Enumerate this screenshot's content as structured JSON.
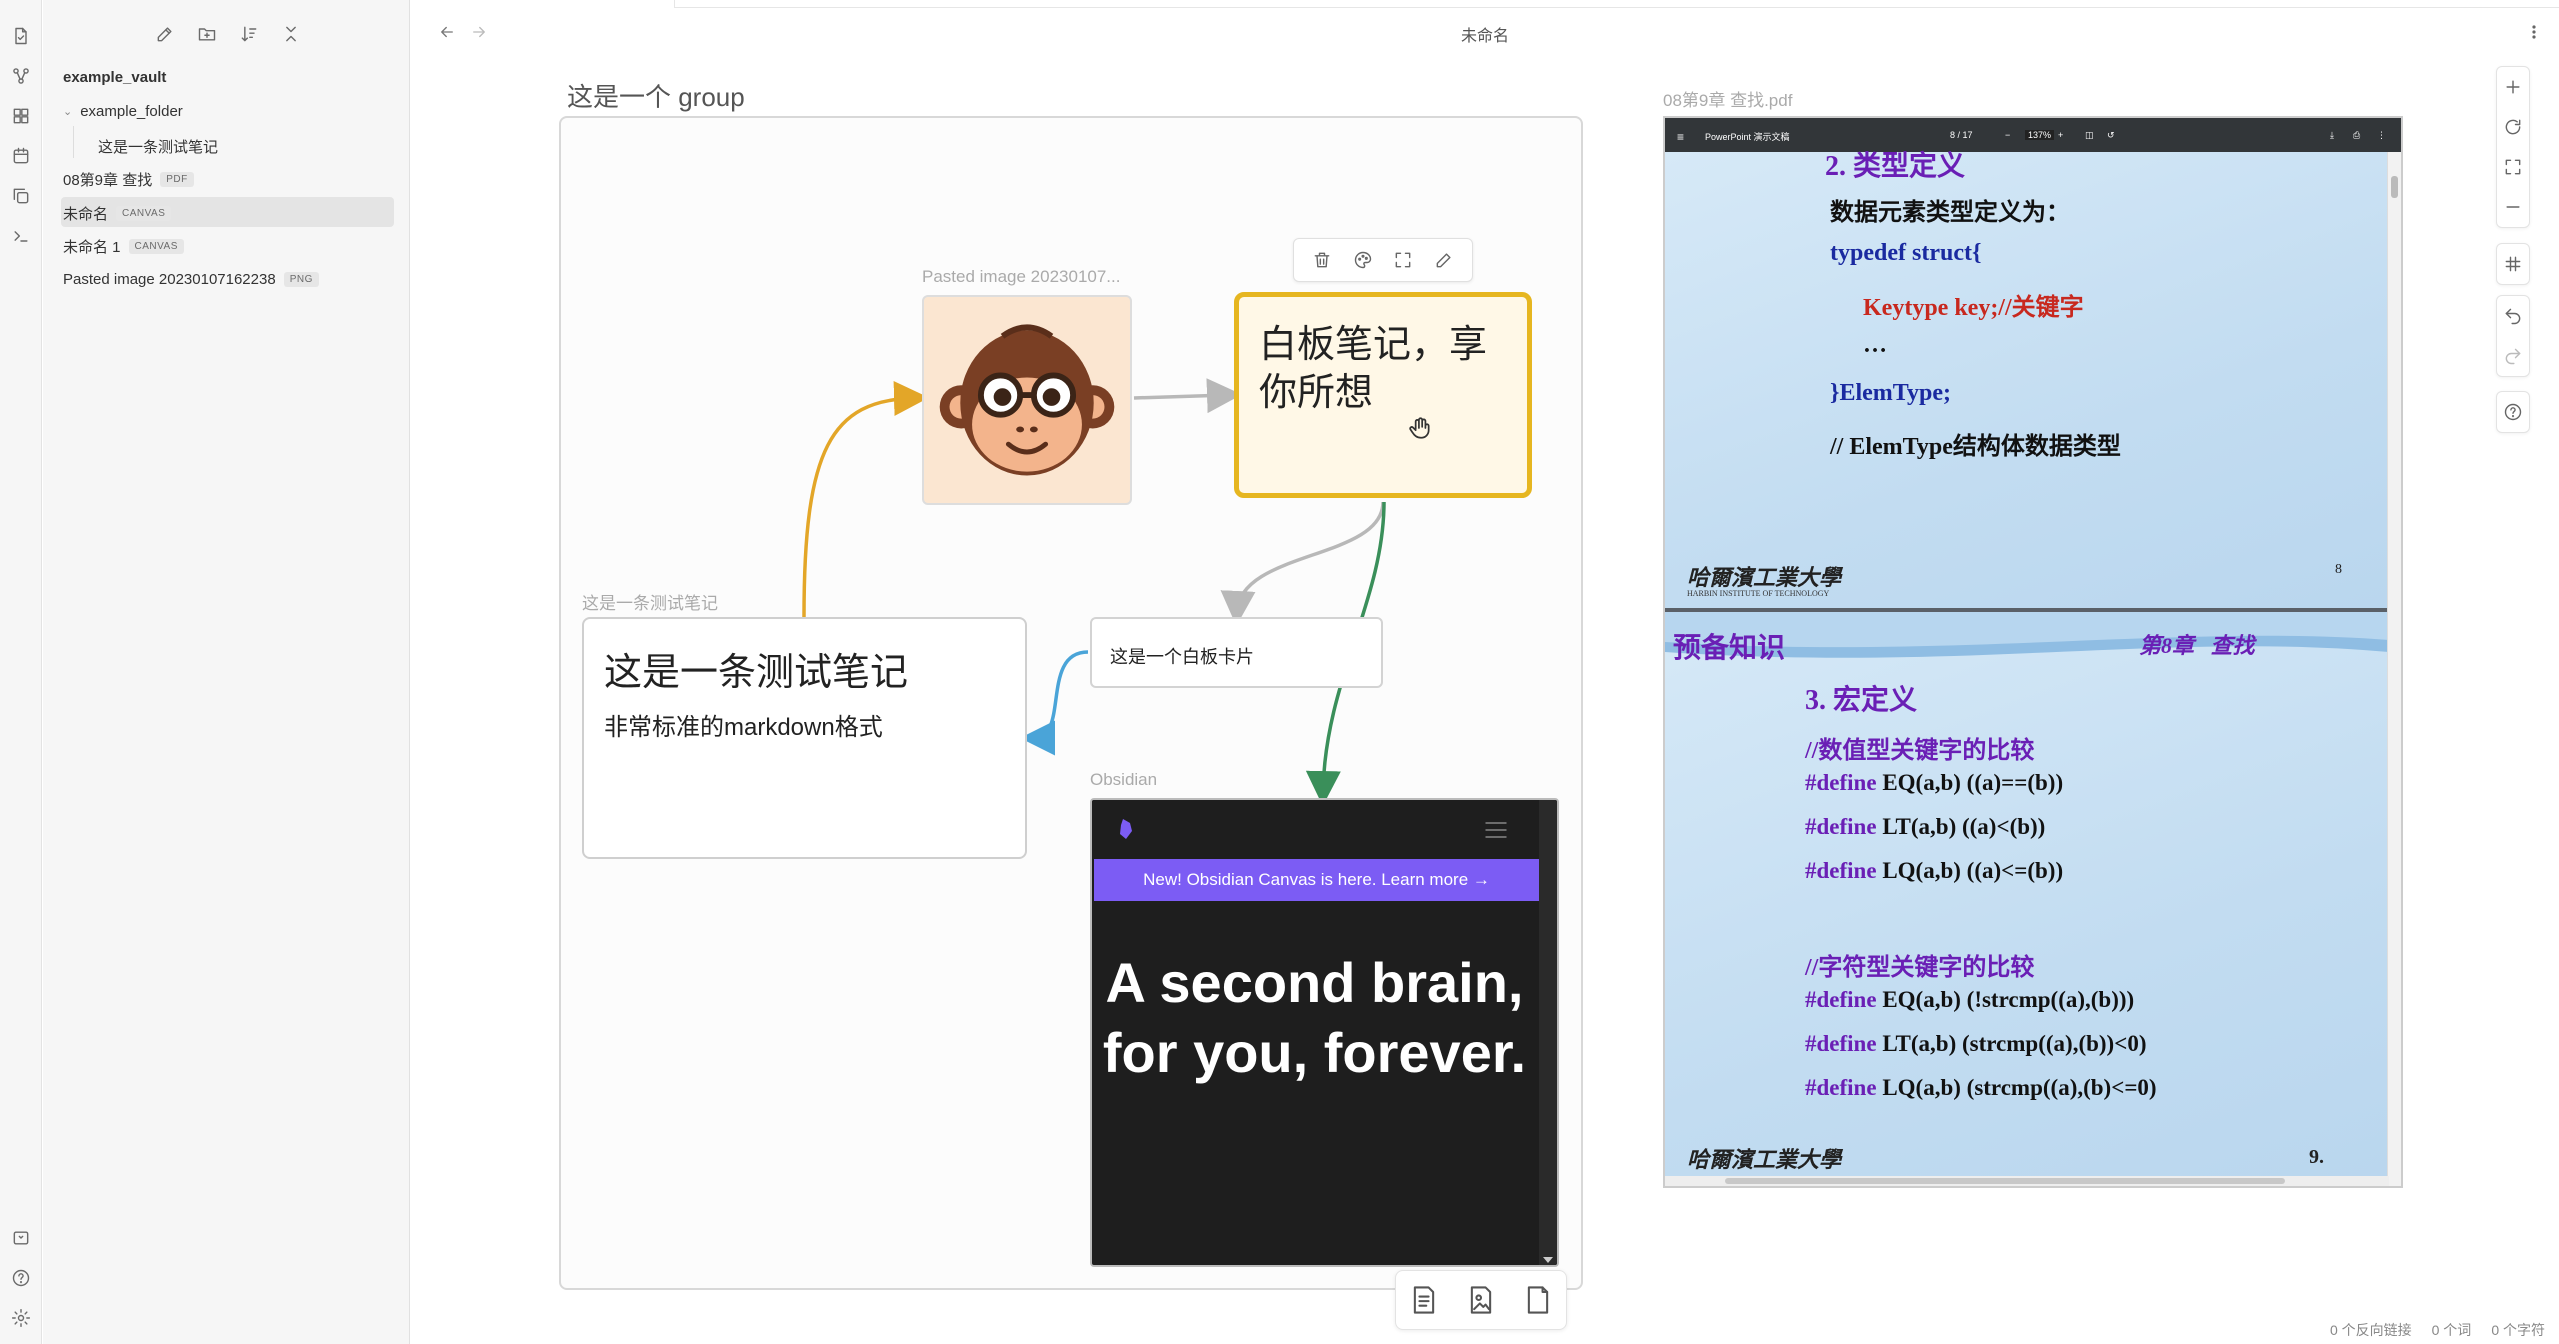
{
  "app": {
    "title": "未命名"
  },
  "ribbon": {
    "top_icons": [
      "file-icon",
      "graph-icon",
      "canvas-icon",
      "calendar-icon",
      "copy-icon",
      "terminal-icon"
    ],
    "bottom_icons": [
      "vault-icon",
      "help-icon",
      "settings-icon"
    ]
  },
  "sidebar": {
    "vault_name": "example_vault",
    "items": [
      {
        "label": "example_folder",
        "badge": "",
        "type": "folder"
      },
      {
        "label": "这是一条测试笔记",
        "badge": "",
        "type": "file"
      },
      {
        "label": "08第9章 查找",
        "badge": "PDF",
        "type": "file"
      },
      {
        "label": "未命名",
        "badge": "CANVAS",
        "type": "file"
      },
      {
        "label": "未命名 1",
        "badge": "CANVAS",
        "type": "file"
      },
      {
        "label": "Pasted image 20230107162238",
        "badge": "PNG",
        "type": "file"
      }
    ]
  },
  "canvas": {
    "group_label": "这是一个 group",
    "image_node_label": "Pasted image 20230107...",
    "yellow_card_text": "白板笔记，享你所想",
    "note_label": "这是一条测试笔记",
    "note_heading": "这是一条测试笔记",
    "note_body": "非常标准的markdown格式",
    "text_card": "这是一个白板卡片",
    "web_label": "Obsidian",
    "web_banner": "New! Obsidian Canvas is here. Learn more →",
    "web_hero": "A second brain, for you, forever.",
    "edge_colors": {
      "orange": "#e3a628",
      "gray": "#b8b8b8",
      "green": "#3a8f5a",
      "blue": "#4aa4d8"
    },
    "card_border": "#e6b620"
  },
  "pdf": {
    "label": "08第9章 查找.pdf",
    "toolbar": {
      "title": "PowerPoint 演示文稿",
      "page": "8 / 17",
      "zoom": "137%"
    },
    "slide1": {
      "heading": "2. 类型定义",
      "lines": [
        "数据元素类型定义为：",
        "typedef struct{",
        "Keytype key;//关键字",
        "…",
        "}ElemType;",
        "// ElemType结构体数据类型"
      ],
      "university": "哈爾濱工業大學",
      "university_en": "HARBIN INSTITUTE OF TECHNOLOGY",
      "page_num": "8"
    },
    "slide2": {
      "banner_left": "预备知识",
      "banner_right": "第8章   查找",
      "heading": "3. 宏定义",
      "comment1": "//数值型关键字的比较",
      "defs1": [
        "EQ(a,b) ((a)==(b))",
        "LT(a,b) ((a)<(b))",
        "LQ(a,b) ((a)<=(b))"
      ],
      "comment2": "//字符型关键字的比较",
      "defs2": [
        "EQ(a,b) (!strcmp((a),(b)))",
        "LT(a,b) (strcmp((a),(b))<0)",
        "LQ(a,b) (strcmp((a),(b)<=0)"
      ],
      "define_kw": "#define",
      "university": "哈爾濱工業大學",
      "page_num": "9."
    }
  },
  "status": {
    "backlinks": "0 个反向链接",
    "words": "0 个词",
    "chars": "0 个字符"
  }
}
